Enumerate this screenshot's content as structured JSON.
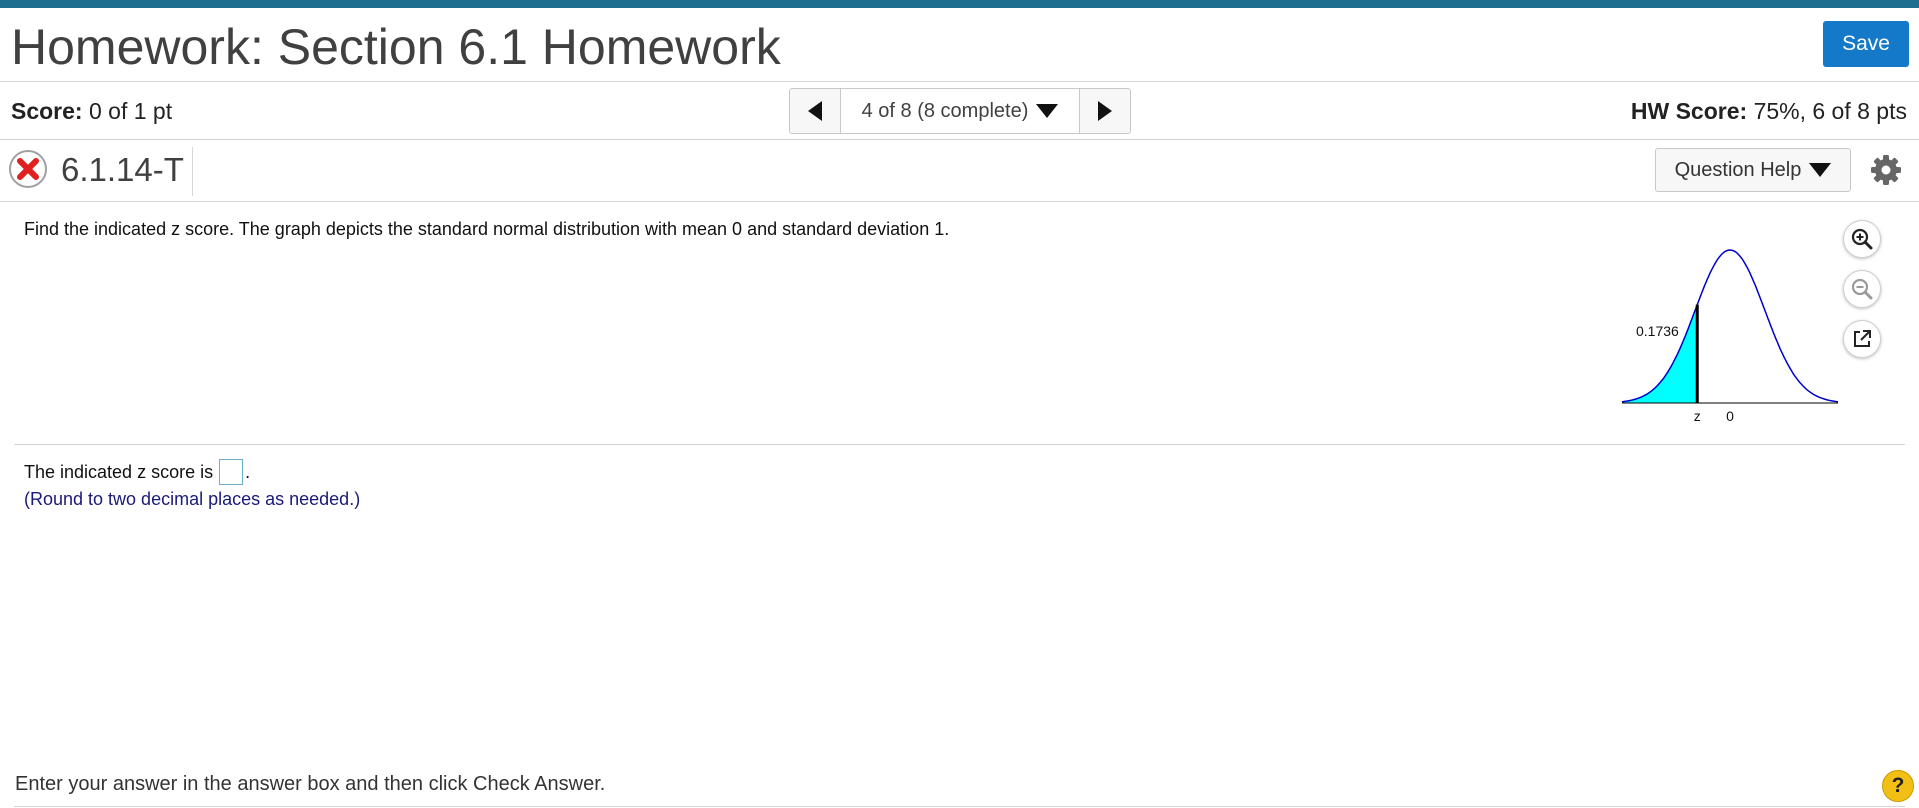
{
  "header": {
    "title": "Homework: Section 6.1 Homework",
    "save_label": "Save",
    "accent_color": "#1e6f8f",
    "save_color": "#1479c9"
  },
  "score": {
    "label": "Score:",
    "value": "0 of 1 pt",
    "hw_label": "HW Score:",
    "hw_value": "75%, 6 of 8 pts"
  },
  "nav": {
    "position_text": "4 of 8 (8 complete)",
    "prev_icon": "triangle-left",
    "next_icon": "triangle-right"
  },
  "question": {
    "status": "incorrect",
    "status_icon": "red-x-icon",
    "id": "6.1.14-T",
    "help_label": "Question Help",
    "prompt": "Find the indicated z score. The graph depicts the standard normal distribution with mean 0 and standard deviation 1.",
    "answer_prefix": "The indicated z score is",
    "answer_suffix": ".",
    "answer_value": "",
    "round_note": "(Round to two decimal places as needed.)"
  },
  "graph": {
    "shaded_area_label": "0.1736",
    "shaded_area": 0.1736,
    "mean": 0,
    "sd": 1,
    "z_label": "z",
    "mean_label": "0",
    "curve_color": "#0000cc",
    "fill_color": "#00ffff",
    "tools": [
      "zoom-in-icon",
      "zoom-out-icon",
      "popout-icon"
    ]
  },
  "footer": {
    "instruction": "Enter your answer in the answer box and then click Check Answer.",
    "help_symbol": "?"
  }
}
